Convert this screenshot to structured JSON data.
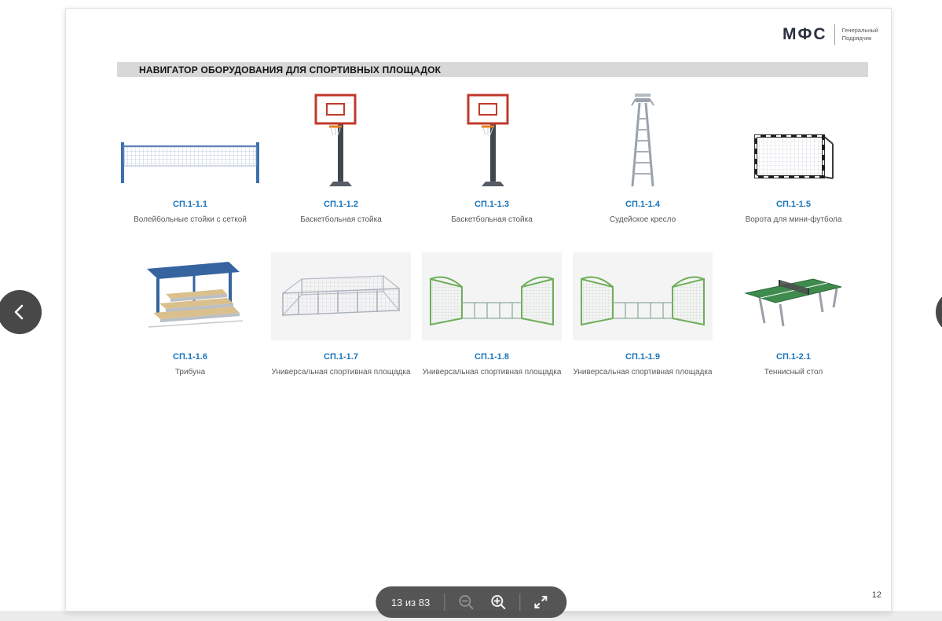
{
  "brand": {
    "name": "МФС",
    "tagline1": "Генеральный",
    "tagline2": "Подрядчик"
  },
  "header": {
    "title": "НАВИГАТОР ОБОРУДОВАНИЯ ДЛЯ СПОРТИВНЫХ ПЛОЩАДОК"
  },
  "items": [
    {
      "code": "СП.1-1.1",
      "caption": "Волейбольные стойки с сеткой",
      "icon": "volleyball-posts-with-net"
    },
    {
      "code": "СП.1-1.2",
      "caption": "Баскетбольная стойка",
      "icon": "basketball-stand"
    },
    {
      "code": "СП.1-1.3",
      "caption": "Баскетбольная стойка",
      "icon": "basketball-stand"
    },
    {
      "code": "СП.1-1.4",
      "caption": "Судейское кресло",
      "icon": "referee-chair"
    },
    {
      "code": "СП.1-1.5",
      "caption": "Ворота для мини-футбола",
      "icon": "mini-football-goal"
    },
    {
      "code": "СП.1-1.6",
      "caption": "Трибуна",
      "icon": "tribune"
    },
    {
      "code": "СП.1-1.7",
      "caption": "Универсальная спортивная площадка",
      "icon": "universal-sports-ground"
    },
    {
      "code": "СП.1-1.8",
      "caption": "Универсальная спортивная площадка",
      "icon": "universal-sports-ground-goals"
    },
    {
      "code": "СП.1-1.9",
      "caption": "Универсальная спортивная площадка",
      "icon": "universal-sports-ground-goals"
    },
    {
      "code": "СП.1-2.1",
      "caption": "Теннисный стол",
      "icon": "tennis-table"
    }
  ],
  "toolbar": {
    "pager": "13 из 83"
  },
  "footer": {
    "page_number": "12"
  },
  "colors": {
    "code_blue": "#1874bc",
    "header_bg": "#d8d8d8",
    "toolbar_bg": "#424242",
    "nav_circle": "#383838"
  }
}
